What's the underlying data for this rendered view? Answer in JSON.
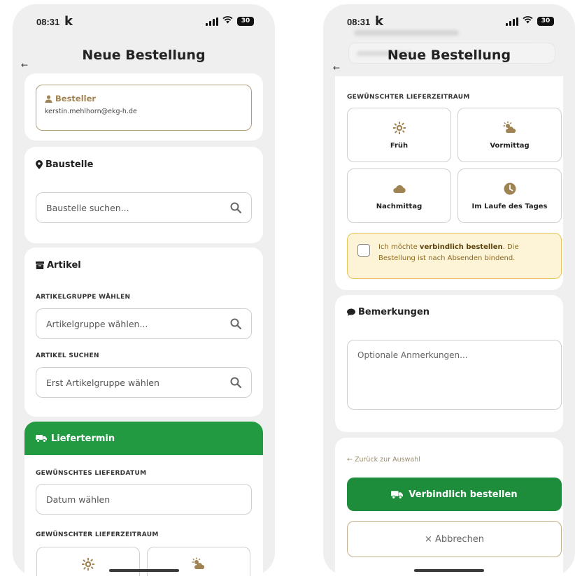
{
  "status": {
    "time": "08:31",
    "carrier_logo": "k",
    "battery": "30"
  },
  "header": {
    "title": "Neue Bestellung",
    "back_icon": "arrow-left-icon"
  },
  "left": {
    "besteller": {
      "label": "Besteller",
      "email": "kerstin.mehlhorn@ekg-h.de"
    },
    "baustelle": {
      "title": "Baustelle",
      "placeholder": "Baustelle suchen..."
    },
    "artikel": {
      "title": "Artikel",
      "group_label": "ARTIKELGRUPPE WÄHLEN",
      "group_placeholder": "Artikelgruppe wählen...",
      "search_label": "ARTIKEL SUCHEN",
      "search_placeholder": "Erst Artikelgruppe wählen"
    },
    "liefertermin": {
      "title": "Liefertermin",
      "date_label": "GEWÜNSCHTES LIEFERDATUM",
      "date_placeholder": "Datum wählen",
      "period_label": "GEWÜNSCHTER LIEFERZEITRAUM"
    }
  },
  "right": {
    "period_label": "GEWÜNSCHTER LIEFERZEITRAUM",
    "periods": [
      {
        "label": "Früh",
        "icon": "sun-icon"
      },
      {
        "label": "Vormittag",
        "icon": "sun-cloud-icon"
      },
      {
        "label": "Nachmittag",
        "icon": "cloud-icon"
      },
      {
        "label": "Im Laufe des Tages",
        "icon": "clock-icon"
      }
    ],
    "confirm": {
      "pre": "Ich möchte ",
      "bold": "verbindlich bestellen",
      "post": ". Die Bestellung ist nach Absenden bindend."
    },
    "bemerkungen": {
      "title": "Bemerkungen",
      "placeholder": "Optionale Anmerkungen..."
    },
    "back_link": "← Zurück zur Auswahl",
    "submit_label": "Verbindlich bestellen",
    "cancel_label": "× Abbrechen"
  },
  "colors": {
    "gold": "#a08352",
    "green": "#229a42",
    "warning_bg": "#fdf3d6",
    "warning_border": "#e8c45a"
  }
}
